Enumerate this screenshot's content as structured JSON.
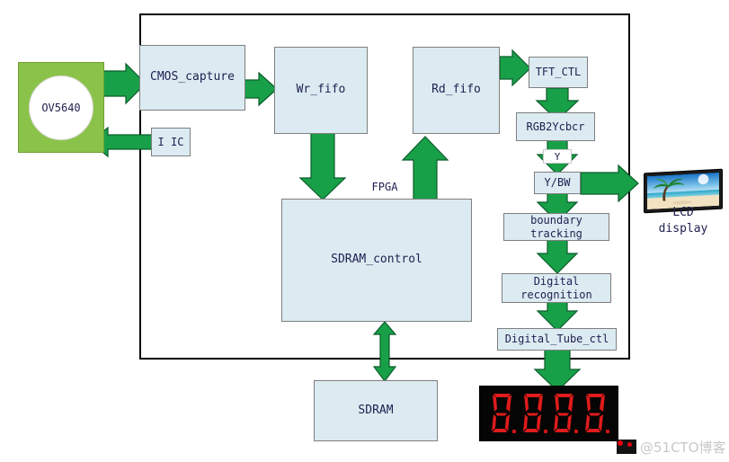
{
  "diagram": {
    "fpga_label": "FPGA",
    "blocks": [
      {
        "id": "cmos_capture",
        "label": "CMOS_capture"
      },
      {
        "id": "wr_fifo",
        "label": "Wr_fifo"
      },
      {
        "id": "iic",
        "label": "I IC"
      },
      {
        "id": "rd_fifo",
        "label": "Rd_fifo"
      },
      {
        "id": "tft_ctl",
        "label": "TFT_CTL"
      },
      {
        "id": "rgb2ycbcr",
        "label": "RGB2Ycbcr"
      },
      {
        "id": "ybw",
        "label": "Y/BW"
      },
      {
        "id": "boundary_l1",
        "label": "boundary"
      },
      {
        "id": "boundary_l2",
        "label": "tracking"
      },
      {
        "id": "digital_l1",
        "label": "Digital"
      },
      {
        "id": "digital_l2",
        "label": "recognition"
      },
      {
        "id": "digital_tube",
        "label": "Digital_Tube_ctl"
      },
      {
        "id": "sdram_control",
        "label": "SDRAM_control"
      },
      {
        "id": "sdram",
        "label": "SDRAM"
      }
    ],
    "camera": {
      "label": "OV5640"
    },
    "edge_tag": {
      "label": "Y"
    },
    "lcd": {
      "line1": "LCD",
      "line2": "display"
    },
    "seven_segment": {
      "digit_count": 4,
      "digits": [
        "8",
        "8",
        "8",
        "8"
      ],
      "on_color": "#e01b1b",
      "off_color": "#2a0a0a",
      "background": "#050505"
    },
    "colors": {
      "block_fill": "#dcebf2",
      "block_border": "#7f7f7f",
      "arrow_green": "#18a048",
      "arrow_outline": "#0b5c2a",
      "camera_green": "#8bc34a",
      "boundary_black": "#000000",
      "text": "#1f1f4f"
    }
  },
  "watermark": {
    "text": "@51CTO博客"
  }
}
